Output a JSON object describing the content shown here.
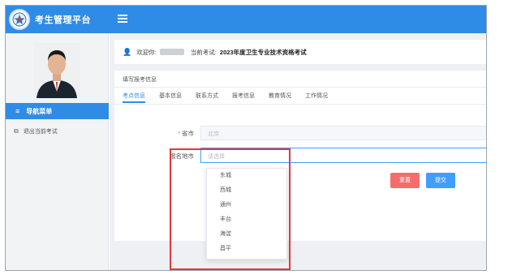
{
  "app": {
    "title": "考生管理平台"
  },
  "sidebar": {
    "nav_header": "导航菜单",
    "items": [
      {
        "label": "退出当前考试"
      }
    ]
  },
  "info_bar": {
    "welcome_label": "欢迎你:",
    "current_exam_label": "当前考试:",
    "current_exam_value": "2023年度卫生专业技术资格考试"
  },
  "form": {
    "title": "填写报考信息",
    "tabs": [
      {
        "label": "考点信息",
        "active": true
      },
      {
        "label": "基本信息",
        "active": false
      },
      {
        "label": "联系方式",
        "active": false
      },
      {
        "label": "报考信息",
        "active": false
      },
      {
        "label": "教育情况",
        "active": false
      },
      {
        "label": "工作情况",
        "active": false
      }
    ],
    "province": {
      "required_mark": "*",
      "label": "省市",
      "value": "北京"
    },
    "region": {
      "label": "报名地市",
      "placeholder": "请选择"
    },
    "region_options": [
      "东城",
      "西城",
      "通州",
      "丰台",
      "海淀",
      "昌平"
    ],
    "reset_label": "重置",
    "submit_label": "提交"
  },
  "colors": {
    "primary": "#2f8ce6",
    "danger": "#f56c6c",
    "link": "#409eff",
    "highlight_box": "#e1373d"
  }
}
